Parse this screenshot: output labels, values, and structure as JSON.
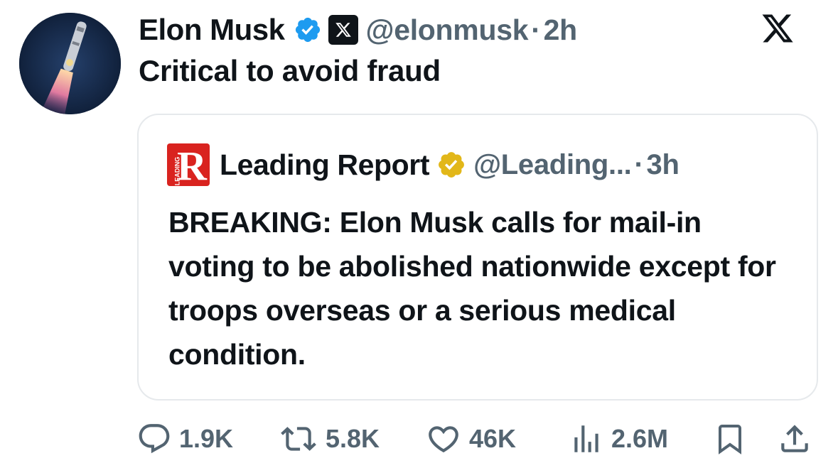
{
  "tweet": {
    "author_name": "Elon Musk",
    "handle": "@elonmusk",
    "separator": "·",
    "time": "2h",
    "text": "Critical to avoid fraud",
    "avatar_icon": "rocket-launch-avatar",
    "verified_color": "#1d9bf0"
  },
  "quote": {
    "author_name": "Leading Report",
    "avatar_letter": "R",
    "avatar_label": "LEADING",
    "handle": "@Leading...",
    "separator": "·",
    "time": "3h",
    "text": "BREAKING: Elon Musk calls for mail-in voting to be abolished nationwide except for troops overseas or a serious medical condition.",
    "badge_color": "#e2b719",
    "avatar_color": "#d9231f"
  },
  "actions": {
    "replies": "1.9K",
    "reposts": "5.8K",
    "likes": "46K",
    "views": "2.6M"
  },
  "colors": {
    "text_primary": "#0f1419",
    "text_secondary": "#536471",
    "border": "#e6e9ec"
  }
}
